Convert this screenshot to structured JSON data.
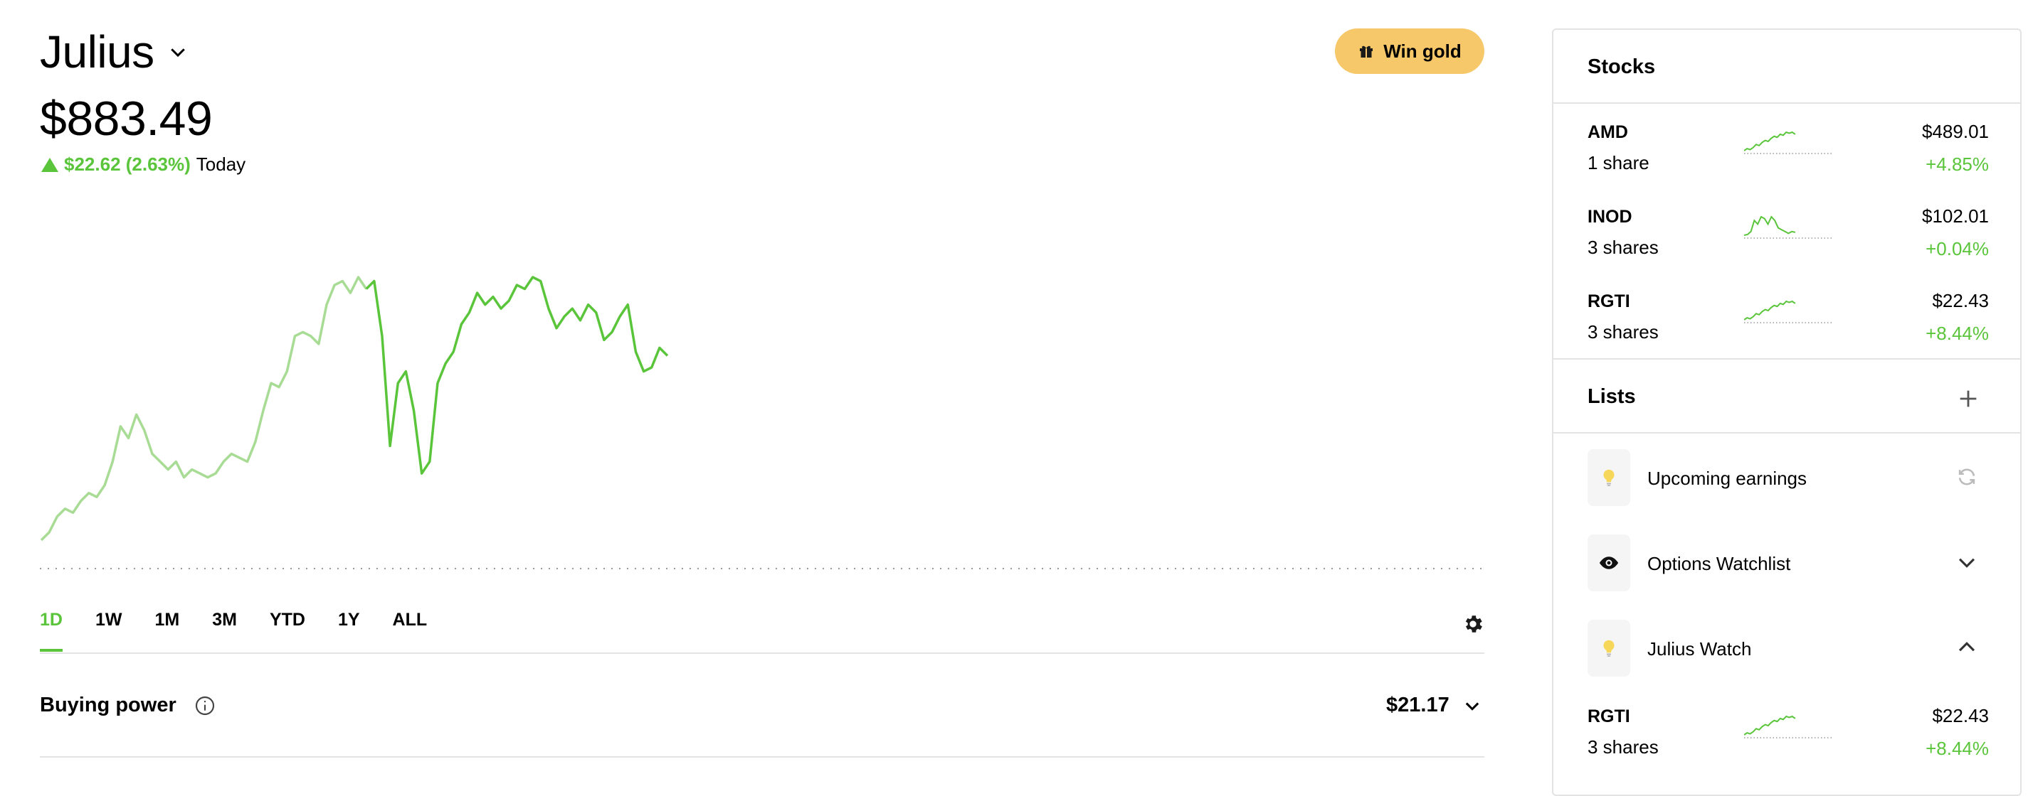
{
  "account": {
    "name": "Julius",
    "value": "$883.49",
    "change": "$22.62 (2.63%)",
    "period": "Today"
  },
  "promo": {
    "label": "Win gold"
  },
  "ranges": [
    "1D",
    "1W",
    "1M",
    "3M",
    "YTD",
    "1Y",
    "ALL"
  ],
  "active_range": "1D",
  "buying_power": {
    "label": "Buying power",
    "value": "$21.17"
  },
  "sidebar": {
    "stocks_title": "Stocks",
    "stocks": [
      {
        "symbol": "AMD",
        "shares": "1 share",
        "price": "$489.01",
        "change": "+4.85%"
      },
      {
        "symbol": "INOD",
        "shares": "3 shares",
        "price": "$102.01",
        "change": "+0.04%"
      },
      {
        "symbol": "RGTI",
        "shares": "3 shares",
        "price": "$22.43",
        "change": "+8.44%"
      }
    ],
    "lists_title": "Lists",
    "lists": [
      {
        "name": "Upcoming earnings",
        "icon": "lightbulb-icon",
        "action": "refresh-icon"
      },
      {
        "name": "Options Watchlist",
        "icon": "eye-icon",
        "action": "chevron-down-icon"
      },
      {
        "name": "Julius Watch",
        "icon": "lightbulb-icon",
        "action": "chevron-up-icon"
      }
    ],
    "watch_items": [
      {
        "symbol": "RGTI",
        "shares": "3 shares",
        "price": "$22.43",
        "change": "+8.44%"
      }
    ]
  },
  "colors": {
    "positive": "#5ac53b",
    "positive_light": "#a8dc95",
    "gold": "#f6c86a",
    "divider": "#e3e3e3"
  },
  "chart_data": {
    "type": "line",
    "note_series": "portfolio value, 1D",
    "x": [
      0,
      1,
      2,
      3,
      4,
      5,
      6,
      7,
      8,
      9,
      10,
      11,
      12,
      13,
      14,
      15,
      16,
      17,
      18,
      19,
      20,
      21,
      22,
      23,
      24,
      25,
      26,
      27,
      28,
      29,
      30,
      31,
      32,
      33,
      34,
      35,
      36,
      37,
      38,
      39,
      40,
      41,
      42,
      43,
      44,
      45,
      46,
      47,
      48,
      49,
      50,
      51,
      52,
      53,
      54,
      55,
      56,
      57,
      58,
      59,
      60,
      61,
      62,
      63,
      64,
      65,
      66,
      67,
      68,
      69,
      70,
      71,
      72,
      73,
      74,
      75,
      76,
      77,
      78,
      79
    ],
    "values": [
      860,
      862,
      866,
      868,
      867,
      870,
      872,
      871,
      874,
      880,
      889,
      886,
      892,
      888,
      882,
      880,
      878,
      880,
      876,
      878,
      877,
      876,
      877,
      880,
      882,
      881,
      880,
      885,
      893,
      900,
      899,
      903,
      912,
      913,
      912,
      910,
      920,
      925,
      926,
      923,
      927,
      924,
      926,
      912,
      884,
      900,
      903,
      893,
      877,
      880,
      900,
      905,
      908,
      915,
      918,
      923,
      920,
      922,
      919,
      921,
      925,
      924,
      927,
      926,
      919,
      914,
      917,
      919,
      916,
      920,
      918,
      911,
      913,
      917,
      920,
      908,
      903,
      904,
      909,
      907
    ],
    "highlight_from": 41
  }
}
